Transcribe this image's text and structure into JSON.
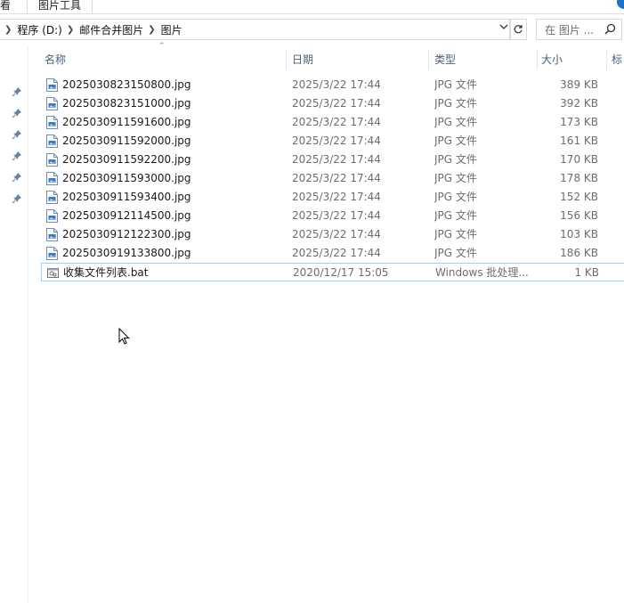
{
  "ribbon": {
    "view_tab": "看",
    "picture_tools_tab": "图片工具"
  },
  "address": {
    "crumbs": [
      "程序 (D:)",
      "邮件合并图片",
      "图片"
    ]
  },
  "search": {
    "placeholder": "在 图片 ..."
  },
  "columns": {
    "name": "名称",
    "date": "日期",
    "type": "类型",
    "size": "大小",
    "tags": "标"
  },
  "files": [
    {
      "name": "2025030823150800.jpg",
      "date": "2025/3/22 17:44",
      "type": "JPG 文件",
      "size": "389 KB",
      "icon": "jpg-file-icon"
    },
    {
      "name": "2025030823151000.jpg",
      "date": "2025/3/22 17:44",
      "type": "JPG 文件",
      "size": "392 KB",
      "icon": "jpg-file-icon"
    },
    {
      "name": "2025030911591600.jpg",
      "date": "2025/3/22 17:44",
      "type": "JPG 文件",
      "size": "173 KB",
      "icon": "jpg-file-icon"
    },
    {
      "name": "2025030911592000.jpg",
      "date": "2025/3/22 17:44",
      "type": "JPG 文件",
      "size": "161 KB",
      "icon": "jpg-file-icon"
    },
    {
      "name": "2025030911592200.jpg",
      "date": "2025/3/22 17:44",
      "type": "JPG 文件",
      "size": "170 KB",
      "icon": "jpg-file-icon"
    },
    {
      "name": "2025030911593000.jpg",
      "date": "2025/3/22 17:44",
      "type": "JPG 文件",
      "size": "178 KB",
      "icon": "jpg-file-icon"
    },
    {
      "name": "2025030911593400.jpg",
      "date": "2025/3/22 17:44",
      "type": "JPG 文件",
      "size": "152 KB",
      "icon": "jpg-file-icon"
    },
    {
      "name": "2025030912114500.jpg",
      "date": "2025/3/22 17:44",
      "type": "JPG 文件",
      "size": "156 KB",
      "icon": "jpg-file-icon"
    },
    {
      "name": "2025030912122300.jpg",
      "date": "2025/3/22 17:44",
      "type": "JPG 文件",
      "size": "103 KB",
      "icon": "jpg-file-icon"
    },
    {
      "name": "2025030919133800.jpg",
      "date": "2025/3/22 17:44",
      "type": "JPG 文件",
      "size": "186 KB",
      "icon": "jpg-file-icon"
    },
    {
      "name": "收集文件列表.bat",
      "date": "2020/12/17 15:05",
      "type": "Windows 批处理...",
      "size": "1 KB",
      "icon": "bat-file-icon",
      "selected": true
    }
  ],
  "colors": {
    "header_text": "#4c607a",
    "selection_border": "#99d1ff",
    "pin": "#6a7ea0"
  }
}
